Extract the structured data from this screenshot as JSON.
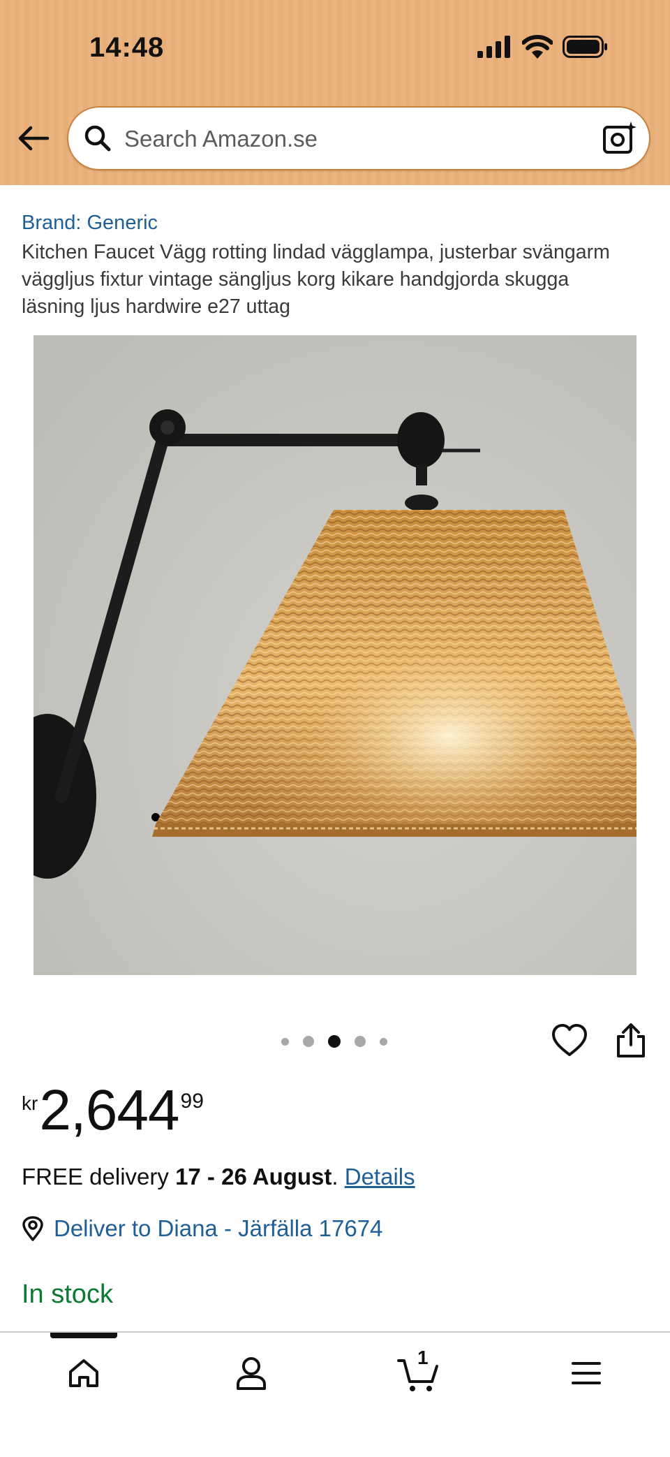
{
  "status_bar": {
    "time": "14:48"
  },
  "search": {
    "placeholder": "Search Amazon.se"
  },
  "product": {
    "brand": "Brand: Generic",
    "title": "Kitchen Faucet Vägg rotting lindad vägglampa, justerbar svängarm väggljus fixtur vintage sängljus korg kikare handgjorda skugga läsning ljus hardwire e27 uttag",
    "image_count": 5,
    "active_image_index": 2
  },
  "price": {
    "currency": "kr",
    "whole": "2,644",
    "fraction": "99"
  },
  "delivery": {
    "prefix": "FREE delivery ",
    "dates": "17 - 26 August",
    "suffix": ". ",
    "details_link": "Details"
  },
  "deliver_to": "Deliver to Diana - Järfälla 17674",
  "stock_status": "In stock",
  "bottom_nav": {
    "cart_count": "1"
  },
  "colors": {
    "header_bg": "#eab37f",
    "link": "#1f5f97",
    "in_stock": "#0a7a33"
  },
  "icons": [
    "back-arrow-icon",
    "search-icon",
    "camera-icon",
    "heart-icon",
    "share-icon",
    "location-icon",
    "home-icon",
    "account-icon",
    "cart-icon",
    "menu-icon"
  ]
}
